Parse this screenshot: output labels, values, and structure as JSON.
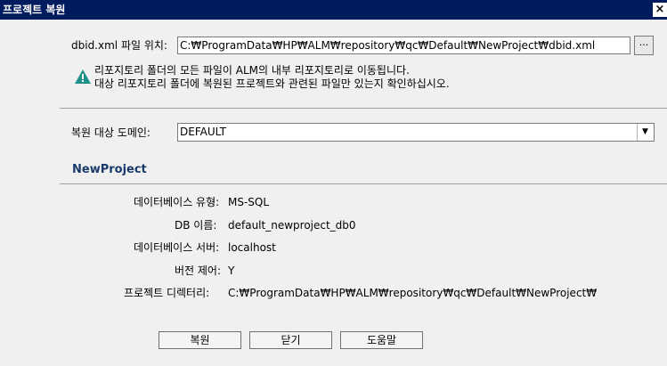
{
  "window": {
    "title": "프로젝트 복원",
    "close_label": "×"
  },
  "dbid": {
    "label": "dbid.xml 파일 위치:",
    "value": "C:₩ProgramData₩HP₩ALM₩repository₩qc₩Default₩NewProject₩dbid.xml",
    "browse_label": "..."
  },
  "notice": {
    "line1": "리포지토리 폴더의 모든 파일이 ALM의 내부 리포지토리로 이동됩니다.",
    "line2": "대상 리포지토리 폴더에 복원된 프로젝트와 관련된 파일만 있는지 확인하십시오.",
    "icon": "warning-icon"
  },
  "domain": {
    "label": "복원 대상 도메인:",
    "value": "DEFAULT"
  },
  "project": {
    "name": "NewProject",
    "details": [
      {
        "label": "데이터베이스 유형:",
        "value": "MS-SQL"
      },
      {
        "label": "DB 이름:",
        "value": "default_newproject_db0"
      },
      {
        "label": "데이터베이스 서버:",
        "value": "localhost"
      },
      {
        "label": "버전 제어:",
        "value": "Y"
      },
      {
        "label": "프로젝트 디렉터리:",
        "value": "C:₩ProgramData₩HP₩ALM₩repository₩qc₩Default₩NewProject₩"
      }
    ]
  },
  "buttons": {
    "restore": "복원",
    "close": "닫기",
    "help": "도움말"
  },
  "colors": {
    "titlebar": "#001b5e",
    "project_name": "#1a3a6b",
    "warning_icon": "#1f8f8a"
  }
}
